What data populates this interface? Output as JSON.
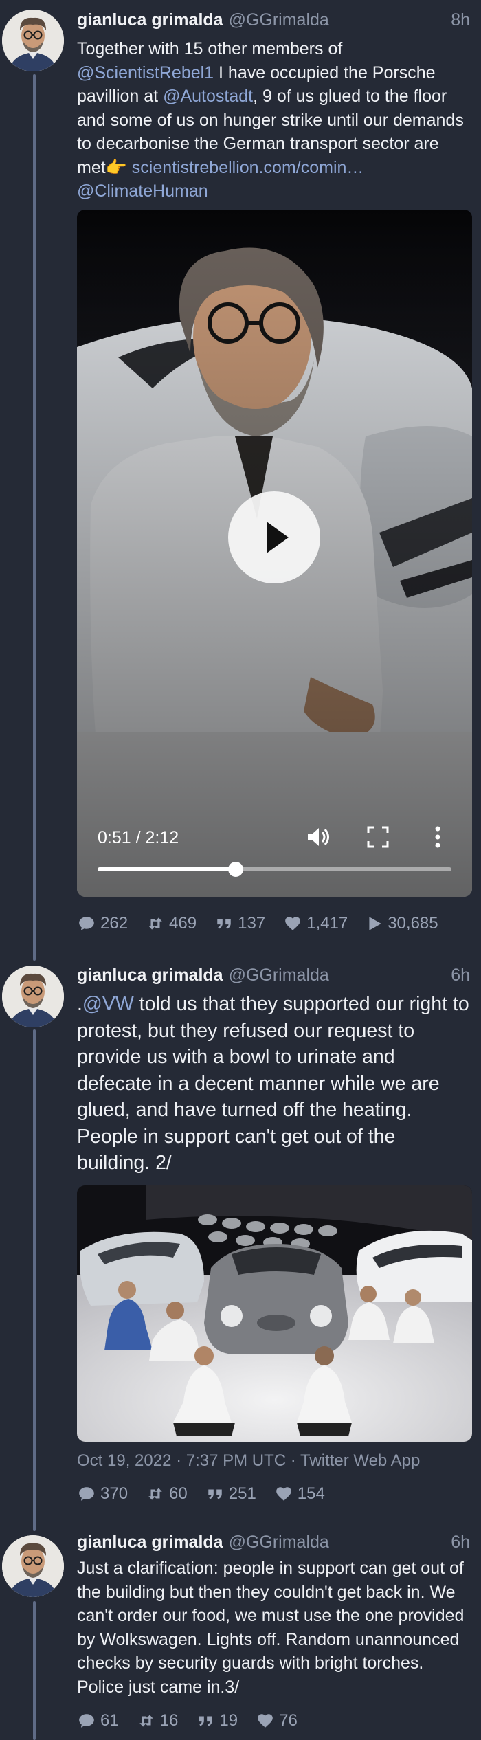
{
  "video_progress_fraction": 0.39,
  "colors": {
    "background": "#252a36",
    "link": "#8fa7d6",
    "muted": "#8c95a7",
    "thread_line": "#5f6b86"
  },
  "tweets": [
    {
      "name": "gianluca grimalda",
      "handle": "@GGrimalda",
      "time": "8h",
      "text": {
        "p1": "Together with 15 other members of ",
        "m1": "@ScientistRebel1",
        "p2": "  I have occupied the Porsche pavillion at ",
        "m2": "@Autostadt",
        "p3": ", 9 of us glued to the floor and some of us on hunger strike until our demands to decarbonise the German transport sector are met",
        "emoji": "👉",
        "url": " scientistrebellion.com/comin…",
        "m3": "@ClimateHuman"
      },
      "video": {
        "time": "0:51 / 2:12"
      },
      "stats": {
        "replies": "262",
        "retweets": "469",
        "quotes": "137",
        "likes": "1,417",
        "views": "30,685"
      }
    },
    {
      "name": "gianluca grimalda",
      "handle": "@GGrimalda",
      "time": "6h",
      "text": {
        "pre": ".",
        "m1": "@VW",
        "p1": " told us that they supported our right to protest, but they refused our request to provide us with a bowl to urinate and defecate in a decent manner while we are glued, and have turned off the heating. People in support can't get out of the building. 2/"
      },
      "meta": "Oct 19, 2022 · 7:37 PM UTC · Twitter Web App",
      "stats": {
        "replies": "370",
        "retweets": "60",
        "quotes": "251",
        "likes": "154"
      }
    },
    {
      "name": "gianluca grimalda",
      "handle": "@GGrimalda",
      "time": "6h",
      "text": {
        "p1": "Just a clarification: people in support can get out of the building but then they couldn't get back in. We can't order our food, we must use the one provided by Wolkswagen.  Lights off. Random unannounced checks by security guards with bright torches. Police just came in.3/"
      },
      "stats": {
        "replies": "61",
        "retweets": "16",
        "quotes": "19",
        "likes": "76"
      }
    }
  ]
}
